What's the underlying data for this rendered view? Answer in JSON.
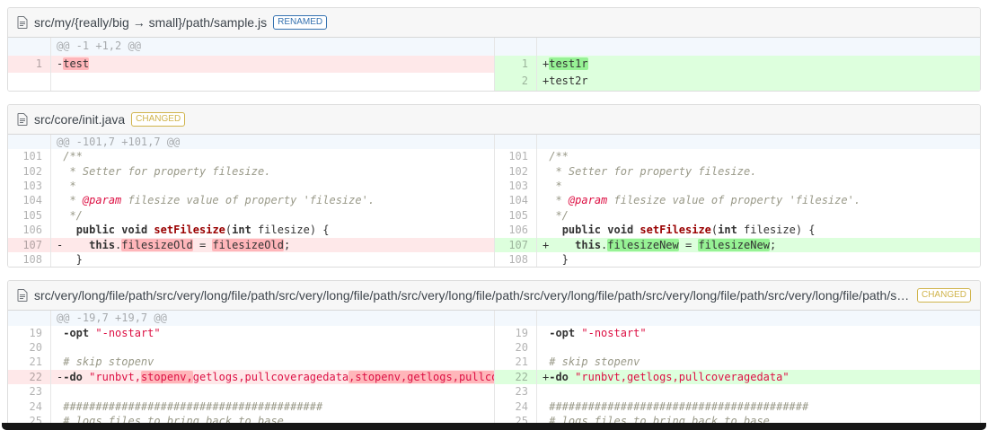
{
  "files": [
    {
      "name": "src/my/{really/big → small}/path/sample.js",
      "tag": {
        "label": "RENAMED",
        "color": "#3572b0"
      },
      "hunk": "@@ -1 +1,2 @@",
      "tall": true,
      "rows": [
        {
          "l": {
            "n": "1",
            "type": "del",
            "parts": [
              [
                "-",
                ""
              ],
              [
                "test",
                "x"
              ]
            ]
          },
          "r": {
            "n": "1",
            "type": "ins",
            "parts": [
              [
                "+",
                ""
              ],
              [
                "test1r",
                "g"
              ]
            ]
          }
        },
        {
          "l": {
            "type": "empty",
            "parts": []
          },
          "r": {
            "n": "2",
            "type": "ins",
            "parts": [
              [
                "+",
                ""
              ],
              [
                "test2r",
                ""
              ]
            ]
          }
        }
      ]
    },
    {
      "name": "src/core/init.java",
      "tag": {
        "label": "CHANGED",
        "color": "#d0b44c"
      },
      "hunk": "@@ -101,7 +101,7 @@",
      "tall": false,
      "rows": [
        {
          "b": {
            "n": "101",
            "type": "ctx",
            "parts": [
              [
                " ",
                ""
              ],
              [
                "/**",
                "c"
              ]
            ]
          }
        },
        {
          "b": {
            "n": "102",
            "type": "ctx",
            "parts": [
              [
                " ",
                ""
              ],
              [
                " * Setter for property filesize.",
                "c"
              ]
            ]
          }
        },
        {
          "b": {
            "n": "103",
            "type": "ctx",
            "parts": [
              [
                " ",
                ""
              ],
              [
                " *",
                "c"
              ]
            ]
          }
        },
        {
          "b": {
            "n": "104",
            "type": "ctx",
            "parts": [
              [
                " ",
                ""
              ],
              [
                " * ",
                "c"
              ],
              [
                "@param",
                "d"
              ],
              [
                " filesize value of property 'filesize'.",
                "c"
              ]
            ]
          }
        },
        {
          "b": {
            "n": "105",
            "type": "ctx",
            "parts": [
              [
                " ",
                ""
              ],
              [
                " */",
                "c"
              ]
            ]
          }
        },
        {
          "b": {
            "n": "106",
            "type": "ctx",
            "parts": [
              [
                " ",
                ""
              ],
              [
                "  ",
                ""
              ],
              [
                "public",
                "k"
              ],
              [
                " ",
                ""
              ],
              [
                "void",
                "k"
              ],
              [
                " ",
                ""
              ],
              [
                "setFilesize",
                "t"
              ],
              [
                "(",
                ""
              ],
              [
                "int",
                "k"
              ],
              [
                " filesize) {",
                ""
              ]
            ]
          }
        },
        {
          "l": {
            "n": "107",
            "type": "del",
            "parts": [
              [
                "-",
                ""
              ],
              [
                "    ",
                ""
              ],
              [
                "this",
                "k"
              ],
              [
                ".",
                ""
              ],
              [
                "filesizeOld",
                "x"
              ],
              [
                " = ",
                ""
              ],
              [
                "filesizeOld",
                "x"
              ],
              [
                ";",
                ""
              ]
            ]
          },
          "r": {
            "n": "107",
            "type": "ins",
            "parts": [
              [
                "+",
                ""
              ],
              [
                "    ",
                ""
              ],
              [
                "this",
                "k"
              ],
              [
                ".",
                ""
              ],
              [
                "filesizeNew",
                "g"
              ],
              [
                " = ",
                ""
              ],
              [
                "filesizeNew",
                "g"
              ],
              [
                ";",
                ""
              ]
            ]
          }
        },
        {
          "b": {
            "n": "108",
            "type": "ctx",
            "parts": [
              [
                " ",
                ""
              ],
              [
                "  }",
                ""
              ]
            ]
          }
        }
      ]
    },
    {
      "name": "src/very/long/file/path/src/very/long/file/path/src/very/long/file/path/src/very/long/file/path/src/very/long/file/path/src/very/long/file/path/src/very/long/file/path/src/very/long…",
      "tag": {
        "label": "CHANGED",
        "color": "#d0b44c"
      },
      "hunk": "@@ -19,7 +19,7 @@",
      "tall": false,
      "rows": [
        {
          "b": {
            "n": "19",
            "type": "ctx",
            "parts": [
              [
                " ",
                ""
              ],
              [
                "-opt",
                "k"
              ],
              [
                " ",
                ""
              ],
              [
                "\"-nostart\"",
                "s"
              ]
            ]
          }
        },
        {
          "b": {
            "n": "20",
            "type": "ctx",
            "parts": []
          }
        },
        {
          "b": {
            "n": "21",
            "type": "ctx",
            "parts": [
              [
                " ",
                ""
              ],
              [
                "# skip stopenv",
                "c"
              ]
            ]
          }
        },
        {
          "l": {
            "n": "22",
            "type": "del",
            "parts": [
              [
                "-",
                ""
              ],
              [
                "-do",
                "k"
              ],
              [
                " ",
                ""
              ],
              [
                "\"runbvt,",
                "s"
              ],
              [
                "stopenv,",
                "s x"
              ],
              [
                "getlogs,pullcoveragedata",
                "s"
              ],
              [
                ",stopenv,getlogs,pullcoveragedata",
                "s x"
              ],
              [
                "\"",
                "s"
              ]
            ]
          },
          "r": {
            "n": "22",
            "type": "ins",
            "parts": [
              [
                "+",
                ""
              ],
              [
                "-do",
                "k"
              ],
              [
                " ",
                ""
              ],
              [
                "\"runbvt,getlogs,pullcoveragedata\"",
                "s"
              ]
            ]
          }
        },
        {
          "b": {
            "n": "23",
            "type": "ctx",
            "parts": []
          }
        },
        {
          "b": {
            "n": "24",
            "type": "ctx",
            "parts": [
              [
                " ",
                ""
              ],
              [
                "########################################",
                "c"
              ]
            ]
          }
        },
        {
          "b": {
            "n": "25",
            "type": "ctx",
            "parts": [
              [
                " ",
                ""
              ],
              [
                "# logs files to bring back to base",
                "c"
              ]
            ]
          }
        }
      ]
    }
  ],
  "colors": {
    "del_line_bg": "#fee8e9",
    "del_word_bg": "#ffb6ba",
    "ins_line_bg": "#ddffdd",
    "ins_word_bg": "#97f295",
    "info_bg": "#f3f8fd",
    "renamed_badge": "#3572b0",
    "changed_badge": "#d0b44c"
  }
}
